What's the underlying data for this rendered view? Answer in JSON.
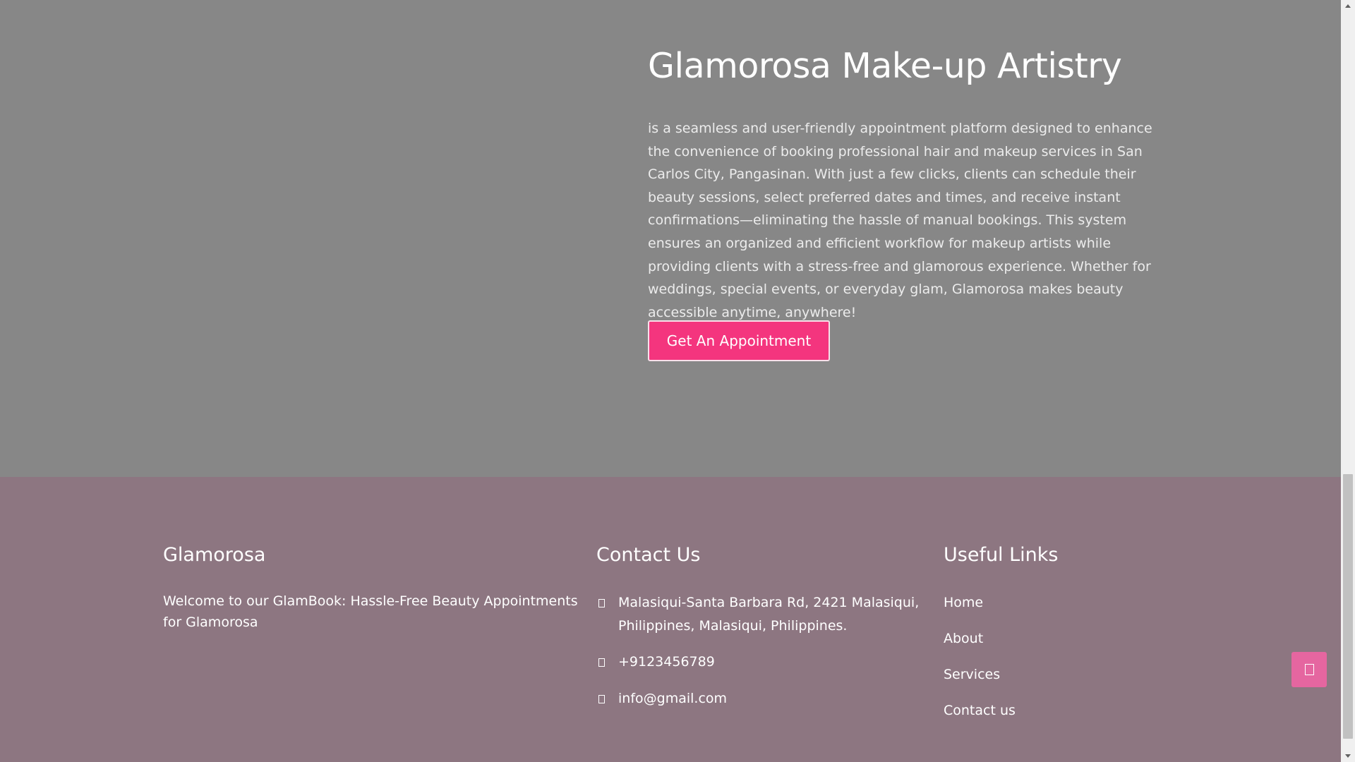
{
  "hero": {
    "title": "Glamorosa Make-up Artistry",
    "description": "is a seamless and user-friendly appointment platform designed to enhance the convenience of booking professional hair and makeup services in San Carlos City, Pangasinan. With just a few clicks, clients can schedule their beauty sessions, select preferred dates and times, and receive instant confirmations—eliminating the hassle of manual bookings. This system ensures an organized and efficient workflow for makeup artists while providing clients with a stress-free and glamorous experience. Whether for weddings, special events, or everyday glam, Glamorosa makes beauty accessible anytime, anywhere!",
    "cta_label": "Get An Appointment"
  },
  "footer": {
    "about": {
      "heading": "Glamorosa",
      "text": "Welcome to our GlamBook: Hassle-Free Beauty Appointments for Glamorosa"
    },
    "contact": {
      "heading": "Contact Us",
      "address": "Malasiqui-Santa Barbara Rd, 2421 Malasiqui, Philippines, Malasiqui, Philippines.",
      "phone": "+9123456789",
      "email": "info@gmail.com"
    },
    "links": {
      "heading": "Useful Links",
      "items": [
        "Home",
        "About",
        "Services",
        "Contact us"
      ]
    }
  },
  "icons": {
    "address": "map-marker-icon",
    "phone": "phone-icon",
    "email": "envelope-icon",
    "back_to_top": "arrow-up-icon"
  },
  "colors": {
    "hero_bg": "#878787",
    "footer_bg": "#8d7681",
    "accent": "#f4357e",
    "back_to_top": "#e566a0"
  }
}
